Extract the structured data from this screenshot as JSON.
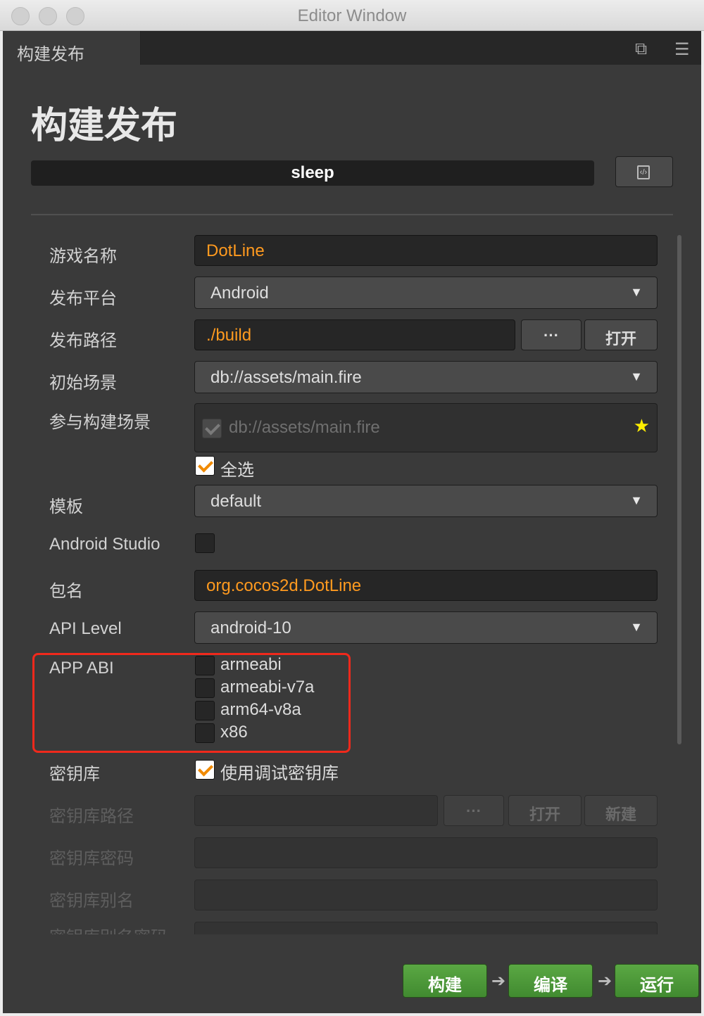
{
  "window": {
    "title": "Editor Window"
  },
  "tab": {
    "label": "构建发布",
    "restore_icon": "restore-window-icon",
    "menu_icon": "hamburger-menu-icon"
  },
  "heading": "构建发布",
  "project": {
    "name": "sleep",
    "json_icon": "code-file-icon"
  },
  "form": {
    "game_name": {
      "label": "游戏名称",
      "value": "DotLine"
    },
    "platform": {
      "label": "发布平台",
      "value": "Android"
    },
    "build_path": {
      "label": "发布路径",
      "value": "./build",
      "browse": "···",
      "open": "打开"
    },
    "start_scene": {
      "label": "初始场景",
      "value": "db://assets/main.fire"
    },
    "scenes": {
      "label": "参与构建场景",
      "items": [
        "db://assets/main.fire"
      ],
      "select_all": "全选"
    },
    "template": {
      "label": "模板",
      "value": "default"
    },
    "android_studio": {
      "label": "Android Studio"
    },
    "package_name": {
      "label": "包名",
      "value": "org.cocos2d.DotLine"
    },
    "api_level": {
      "label": "API Level",
      "value": "android-10"
    },
    "app_abi": {
      "label": "APP ABI",
      "options": [
        "armeabi",
        "armeabi-v7a",
        "arm64-v8a",
        "x86"
      ]
    },
    "keystore": {
      "label": "密钥库",
      "use_debug": "使用调试密钥库"
    },
    "keystore_path": {
      "label": "密钥库路径",
      "browse": "···",
      "open": "打开",
      "new": "新建"
    },
    "keystore_password": {
      "label": "密钥库密码"
    },
    "keystore_alias": {
      "label": "密钥库别名"
    },
    "keystore_alias_password": {
      "label": "密钥库别名密码"
    }
  },
  "actions": {
    "build": "构建",
    "compile": "编译",
    "run": "运行"
  },
  "colors": {
    "accent": "#ff9a1f",
    "run_green": "#4e9a3a",
    "highlight_red": "#f0291c"
  }
}
